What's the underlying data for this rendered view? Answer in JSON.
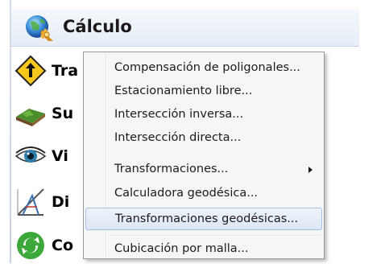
{
  "panel": {
    "header": {
      "label": "Cálculo",
      "icon": "calculation-globe-icon"
    },
    "items": [
      {
        "label": "Tra",
        "icon": "traffic-sign-icon"
      },
      {
        "label": "Su",
        "icon": "surface-terrain-icon"
      },
      {
        "label": "Vi",
        "icon": "eye-icon"
      },
      {
        "label": "Di",
        "icon": "drawing-tools-icon"
      },
      {
        "label": "Co",
        "icon": "sync-arrows-icon"
      }
    ]
  },
  "menu": {
    "items": [
      {
        "label": "Compensación de poligonales...",
        "has_submenu": false,
        "highlighted": false
      },
      {
        "label": "Estacionamiento libre...",
        "has_submenu": false,
        "highlighted": false
      },
      {
        "label": "Intersección inversa...",
        "has_submenu": false,
        "highlighted": false
      },
      {
        "label": "Intersección directa...",
        "has_submenu": false,
        "highlighted": false
      },
      {
        "label": "Transformaciones...",
        "has_submenu": true,
        "highlighted": false
      },
      {
        "label": "Calculadora geodésica...",
        "has_submenu": false,
        "highlighted": false
      },
      {
        "label": "Transformaciones geodésicas...",
        "has_submenu": false,
        "highlighted": true
      },
      {
        "label": "Cubicación por malla...",
        "has_submenu": false,
        "highlighted": false
      }
    ]
  },
  "colors": {
    "menu_background": "#f5f6f7",
    "menu_border": "#979797",
    "highlight_border": "#a8c1e2"
  }
}
